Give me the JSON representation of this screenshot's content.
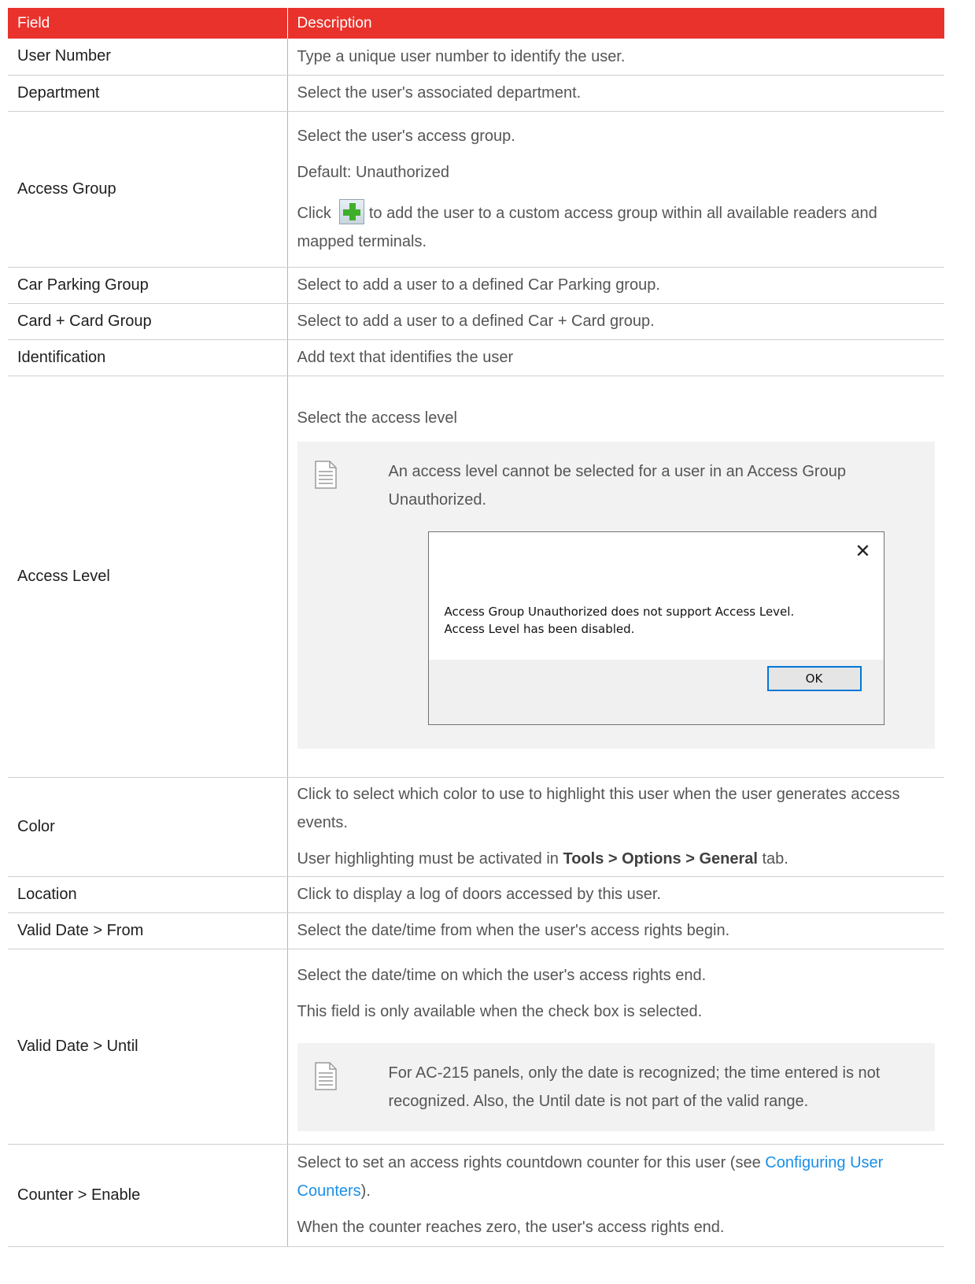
{
  "table": {
    "headers": {
      "field": "Field",
      "description": "Description"
    },
    "rows": [
      {
        "field": "User Number",
        "desc": [
          "Type a unique user number to identify the user."
        ]
      },
      {
        "field": "Department",
        "desc": [
          "Select the user's associated department."
        ]
      },
      {
        "field": "Access Group",
        "desc": [
          "Select the user's access group.",
          "Default: Unauthorized"
        ],
        "click_text": {
          "prefix": "Click",
          "suffix": "to add the user to a custom access group within all available readers and mapped terminals."
        }
      },
      {
        "field": "Car Parking Group",
        "desc": [
          "Select to add a user to a defined Car Parking group."
        ]
      },
      {
        "field": "Card + Card Group",
        "desc": [
          "Select to add a user to a defined Car + Card group."
        ]
      },
      {
        "field": "Identification",
        "desc": [
          "Add text that identifies the user"
        ]
      },
      {
        "field": "Access Level",
        "desc": [
          "Select the access level"
        ],
        "note": "An access level cannot be selected for a user in an Access Group Unauthorized."
      },
      {
        "field": "Color",
        "desc": [
          "Click to select which color to use to highlight this user when the user generates access events."
        ],
        "highlight": {
          "before": "User highlighting must be activated in",
          "bold": "Tools > Options > General",
          "after": "tab."
        }
      },
      {
        "field": "Location",
        "desc": [
          "Click to display a log of doors accessed by this user."
        ]
      },
      {
        "field": "Valid Date > From",
        "desc": [
          "Select the date/time from when the user's access rights begin."
        ]
      },
      {
        "field": "Valid Date > Until",
        "desc": [
          "Select the date/time on which the user's access rights end.",
          "This field is only available when the check box is selected."
        ],
        "note": "For AC-215 panels, only the date is recognized; the time entered is not recognized. Also, the Until date is not part of the valid range."
      },
      {
        "field": "Counter > Enable",
        "desc": [
          "When the counter reaches zero, the user's access rights end."
        ],
        "counter": {
          "before": "Select to set an access rights countdown counter for this user (see",
          "link": "Configuring User Counters",
          "after": ")."
        }
      }
    ]
  },
  "dialog": {
    "message_line1": "Access Group Unauthorized does not support Access Level.",
    "message_line2": "Access Level has been disabled.",
    "ok_label": "OK",
    "close_glyph": "✕"
  },
  "icons": {
    "add": "plus-icon",
    "note": "document-icon"
  },
  "colors": {
    "header_bg": "#e8322b",
    "link": "#1a8fe6"
  }
}
